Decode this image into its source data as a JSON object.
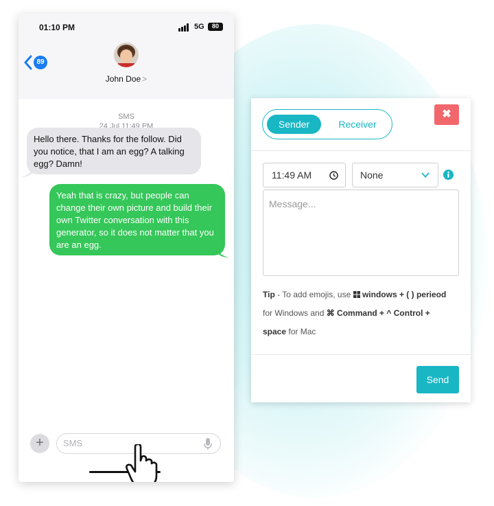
{
  "status_bar": {
    "time": "01:10 PM",
    "network": "5G",
    "battery": "80"
  },
  "header": {
    "back_badge": "89",
    "contact_name": "John Doe",
    "contact_chevron": ">"
  },
  "chat": {
    "service_label": "SMS",
    "timestamp": "24 Jul 11:49 PM",
    "messages": [
      {
        "direction": "received",
        "text": "Hello there. Thanks for the follow. Did you notice, that I am an egg? A talking egg? Damn!"
      },
      {
        "direction": "sent",
        "text": "Yeah that is crazy, but people can change their own picture and build their own Twitter conversation with this generator, so it does not matter that you are an egg."
      }
    ]
  },
  "composer": {
    "plus_label": "+",
    "placeholder": "SMS"
  },
  "dialog": {
    "tabs": {
      "sender": "Sender",
      "receiver": "Receiver"
    },
    "close_label": "✖",
    "time_value": "11:49 AM",
    "select_value": "None",
    "message_placeholder": "Message...",
    "tip": {
      "prefix": "Tip",
      "line1": " - To add emojis, use ",
      "win_keys": "windows + ( ) perieod",
      "line2_a": "for Windows and ",
      "mac_keys": "⌘ Command + ^ Control + ",
      "space_key": "space",
      "line2_b": " for Mac"
    },
    "send_label": "Send"
  },
  "colors": {
    "accent": "#19b6c4",
    "sent_bubble": "#35c759",
    "received_bubble": "#e5e5ea",
    "close": "#f2676b",
    "ios_blue": "#1a7cf4"
  },
  "icons": [
    "back-chevron-icon",
    "signal-icon",
    "battery-icon",
    "avatar",
    "plus-icon",
    "mic-icon",
    "hand-cursor-icon",
    "close-icon",
    "clock-icon",
    "chevron-down-icon",
    "info-icon",
    "windows-icon"
  ]
}
